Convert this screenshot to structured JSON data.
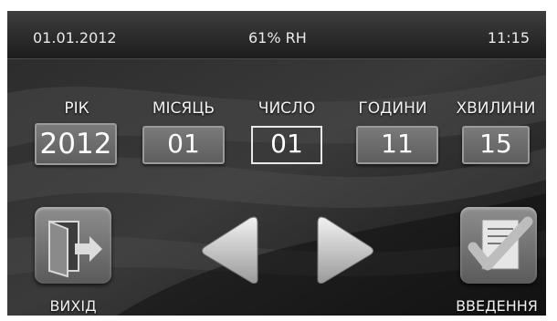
{
  "status": {
    "date": "01.01.2012",
    "humidity": "61% RH",
    "time": "11:15"
  },
  "fields": [
    {
      "label": "РІК",
      "value": "2012"
    },
    {
      "label": "МІСЯЦЬ",
      "value": "01"
    },
    {
      "label": "ЧИСЛО",
      "value": "01"
    },
    {
      "label": "ГОДИНИ",
      "value": "11"
    },
    {
      "label": "ХВИЛИНИ",
      "value": "15"
    }
  ],
  "buttons": {
    "exit_label": "ВИХІД",
    "enter_label": "ВВЕДЕННЯ"
  },
  "icons": [
    "exit-door-icon",
    "arrow-left-icon",
    "arrow-right-icon",
    "document-checkmark-icon"
  ]
}
